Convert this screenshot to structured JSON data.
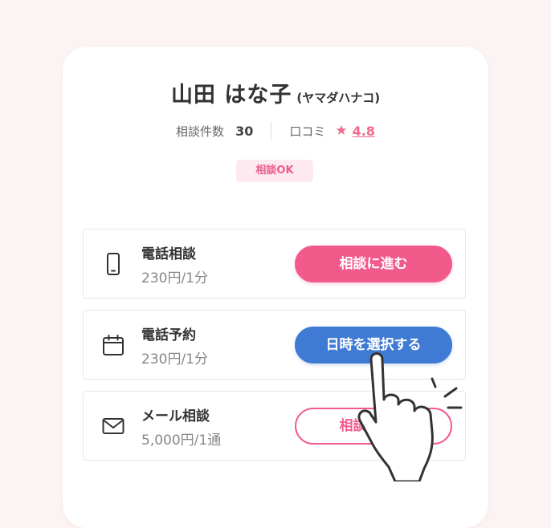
{
  "profile": {
    "name": "山田 はな子",
    "kana": "(ヤマダハナコ)",
    "consult_count_label": "相談件数",
    "consult_count": "30",
    "review_label": "口コミ",
    "rating": "4.8",
    "badge": "相談OK"
  },
  "options": [
    {
      "icon": "smartphone-icon",
      "title": "電話相談",
      "price": "230円/1分",
      "button": "相談に進む",
      "button_style": "pink"
    },
    {
      "icon": "calendar-icon",
      "title": "電話予約",
      "price": "230円/1分",
      "button": "日時を選択する",
      "button_style": "blue"
    },
    {
      "icon": "mail-icon",
      "title": "メール相談",
      "price": "5,000円/1通",
      "button": "相談に進む",
      "button_style": "outline"
    }
  ],
  "colors": {
    "accent_pink": "#f25a8c",
    "accent_blue": "#3f7ad4",
    "background": "#fcf4f4"
  }
}
